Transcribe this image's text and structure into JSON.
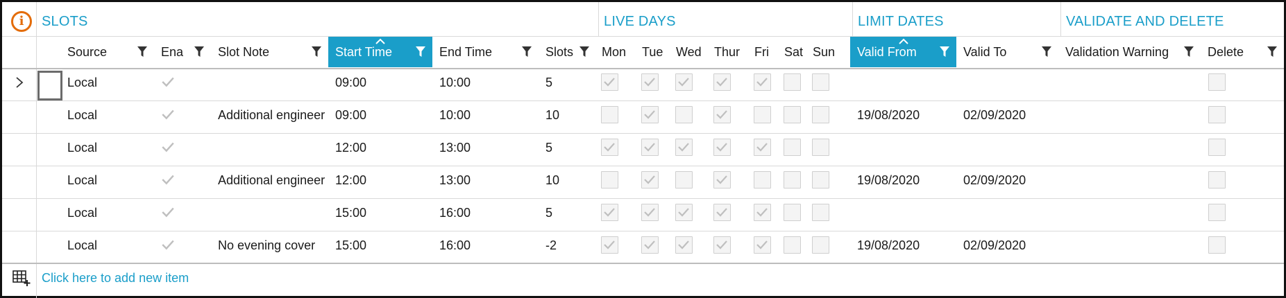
{
  "groups": {
    "slots": "SLOTS",
    "live_days": "LIVE DAYS",
    "limit_dates": "LIMIT DATES",
    "validate_and_delete": "VALIDATE AND DELETE"
  },
  "columns": {
    "source": "Source",
    "enabled": "Ena",
    "slot_note": "Slot Note",
    "start_time": "Start Time",
    "end_time": "End Time",
    "slots": "Slots",
    "mon": "Mon",
    "tue": "Tue",
    "wed": "Wed",
    "thur": "Thur",
    "fri": "Fri",
    "sat": "Sat",
    "sun": "Sun",
    "valid_from": "Valid From",
    "valid_to": "Valid To",
    "validation_warning": "Validation Warning",
    "delete": "Delete"
  },
  "sorted_columns": [
    "start_time",
    "valid_from"
  ],
  "accent_color": "#1a9ec9",
  "info_color": "#e36c09",
  "rows": [
    {
      "source": "Local",
      "enabled": true,
      "slot_note": "",
      "start_time": "09:00",
      "end_time": "10:00",
      "slots": "5",
      "days": [
        true,
        true,
        true,
        true,
        true,
        false,
        false
      ],
      "valid_from": "",
      "valid_to": "",
      "validation_warning": "",
      "delete": false
    },
    {
      "source": "Local",
      "enabled": true,
      "slot_note": "Additional engineer",
      "start_time": "09:00",
      "end_time": "10:00",
      "slots": "10",
      "days": [
        false,
        true,
        false,
        true,
        false,
        false,
        false
      ],
      "valid_from": "19/08/2020",
      "valid_to": "02/09/2020",
      "validation_warning": "",
      "delete": false
    },
    {
      "source": "Local",
      "enabled": true,
      "slot_note": "",
      "start_time": "12:00",
      "end_time": "13:00",
      "slots": "5",
      "days": [
        true,
        true,
        true,
        true,
        true,
        false,
        false
      ],
      "valid_from": "",
      "valid_to": "",
      "validation_warning": "",
      "delete": false
    },
    {
      "source": "Local",
      "enabled": true,
      "slot_note": "Additional engineer",
      "start_time": "12:00",
      "end_time": "13:00",
      "slots": "10",
      "days": [
        false,
        true,
        false,
        true,
        false,
        false,
        false
      ],
      "valid_from": "19/08/2020",
      "valid_to": "02/09/2020",
      "validation_warning": "",
      "delete": false
    },
    {
      "source": "Local",
      "enabled": true,
      "slot_note": "",
      "start_time": "15:00",
      "end_time": "16:00",
      "slots": "5",
      "days": [
        true,
        true,
        true,
        true,
        true,
        false,
        false
      ],
      "valid_from": "",
      "valid_to": "",
      "validation_warning": "",
      "delete": false
    },
    {
      "source": "Local",
      "enabled": true,
      "slot_note": "No evening cover",
      "start_time": "15:00",
      "end_time": "16:00",
      "slots": "-2",
      "days": [
        true,
        true,
        true,
        true,
        true,
        false,
        false
      ],
      "valid_from": "19/08/2020",
      "valid_to": "02/09/2020",
      "validation_warning": "",
      "delete": false
    }
  ],
  "footer": {
    "add_new_item": "Click here to add new item",
    "add_icon": "add-row-grid-icon"
  },
  "icons": {
    "info": "info-icon",
    "filter": "filter-icon",
    "sort": "sort-ascending-icon",
    "expand": "chevron-right-icon",
    "check": "checkmark-icon"
  }
}
